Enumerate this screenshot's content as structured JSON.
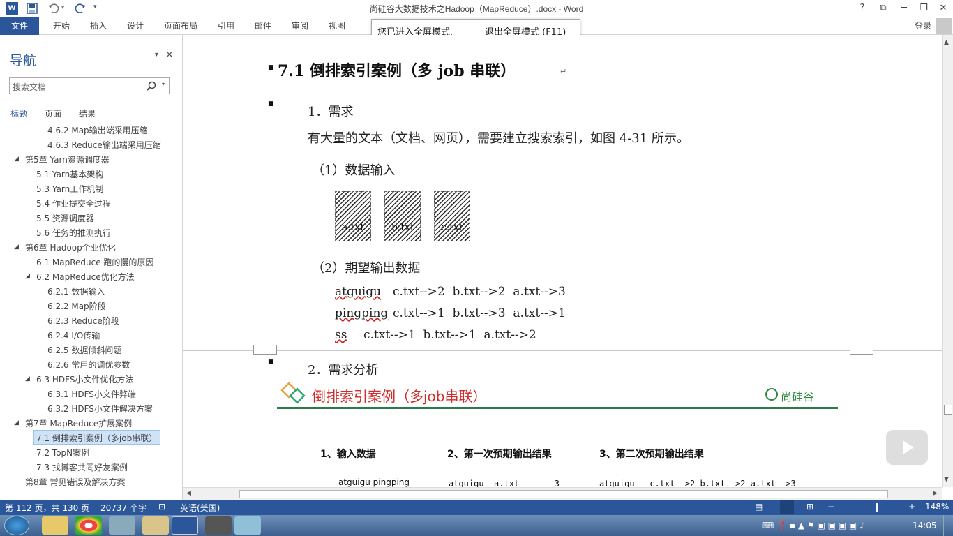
{
  "window": {
    "title": "尚硅谷大数据技术之Hadoop（MapReduce）.docx - Word",
    "word_logo": "W",
    "help": "?",
    "restore": "⧉",
    "minimize": "─",
    "maximize": "❐",
    "close": "✕"
  },
  "ribbon": {
    "tabs": [
      "文件",
      "开始",
      "插入",
      "设计",
      "页面布局",
      "引用",
      "邮件",
      "审阅",
      "视图"
    ],
    "login": "登录"
  },
  "fullscreen_tip": {
    "message": "您已进入全屏模式.",
    "exit_link": "退出全屏模式 (F11)"
  },
  "nav": {
    "title": "导航",
    "search_placeholder": "搜索文档",
    "tabs": [
      "标题",
      "页面",
      "结果"
    ],
    "tree": [
      {
        "text": "4.6.2 Map输出端采用压缩",
        "level": 3,
        "arrow": ""
      },
      {
        "text": "4.6.3 Reduce输出端采用压缩",
        "level": 3,
        "arrow": ""
      },
      {
        "text": "第5章 Yarn资源调度器",
        "level": 1,
        "arrow": "◢"
      },
      {
        "text": "5.1 Yarn基本架构",
        "level": 2,
        "arrow": ""
      },
      {
        "text": "5.3 Yarn工作机制",
        "level": 2,
        "arrow": ""
      },
      {
        "text": "5.4 作业提交全过程",
        "level": 2,
        "arrow": ""
      },
      {
        "text": "5.5 资源调度器",
        "level": 2,
        "arrow": ""
      },
      {
        "text": "5.6 任务的推测执行",
        "level": 2,
        "arrow": ""
      },
      {
        "text": "第6章 Hadoop企业优化",
        "level": 1,
        "arrow": "◢"
      },
      {
        "text": "6.1 MapReduce 跑的慢的原因",
        "level": 2,
        "arrow": ""
      },
      {
        "text": "6.2 MapReduce优化方法",
        "level": 2,
        "arrow": "◢"
      },
      {
        "text": "6.2.1 数据输入",
        "level": 3,
        "arrow": ""
      },
      {
        "text": "6.2.2 Map阶段",
        "level": 3,
        "arrow": ""
      },
      {
        "text": "6.2.3 Reduce阶段",
        "level": 3,
        "arrow": ""
      },
      {
        "text": "6.2.4 I/O传输",
        "level": 3,
        "arrow": ""
      },
      {
        "text": "6.2.5 数据倾斜问题",
        "level": 3,
        "arrow": ""
      },
      {
        "text": "6.2.6 常用的调优参数",
        "level": 3,
        "arrow": ""
      },
      {
        "text": "6.3 HDFS小文件优化方法",
        "level": 2,
        "arrow": "◢"
      },
      {
        "text": "6.3.1 HDFS小文件弊端",
        "level": 3,
        "arrow": ""
      },
      {
        "text": "6.3.2 HDFS小文件解决方案",
        "level": 3,
        "arrow": ""
      },
      {
        "text": "第7章 MapReduce扩展案例",
        "level": 1,
        "arrow": "◢"
      },
      {
        "text": "7.1 倒排索引案例（多job串联）",
        "level": 2,
        "arrow": ""
      },
      {
        "text": "7.2 TopN案例",
        "level": 2,
        "arrow": ""
      },
      {
        "text": "7.3 找博客共同好友案例",
        "level": 2,
        "arrow": ""
      },
      {
        "text": "第8章 常见错误及解决方案",
        "level": 1,
        "arrow": ""
      }
    ]
  },
  "doc": {
    "heading": "7.1  倒排索引案例（多 job 串联）",
    "sec1": "1．需求",
    "desc": "有大量的文本（文档、网页），需要建立搜索索引，如图 4-31 所示。",
    "input_title": "（1）数据输入",
    "files": [
      "a.txt",
      "b.txt",
      "c.txt"
    ],
    "output_title": "（2）期望输出数据",
    "rows": [
      {
        "word": "atguigu",
        "values": "c.txt-->2  b.txt-->2  a.txt-->3"
      },
      {
        "word": "pingping",
        "values": "c.txt-->1  b.txt-->3  a.txt-->1"
      },
      {
        "word": "ss",
        "values": "c.txt-->1  b.txt-->1  a.txt-->2"
      }
    ],
    "sec2": "2．需求分析",
    "banner_title": "倒排索引案例（多job串联）",
    "banner_logo": "尚硅谷",
    "cols": [
      "1、输入数据",
      "2、第一次预期输出结果",
      "3、第二次预期输出结果"
    ],
    "col_row": [
      "atguigu pingping",
      "atguigu--a.txt       3",
      "atguigu   c.txt-->2 b.txt-->2 a.txt-->3"
    ]
  },
  "status": {
    "page": "第 112 页，共 130 页",
    "words": "20737 个字",
    "lang": "英语(美国)",
    "zoom": "148%"
  },
  "taskbar": {
    "time": "14:05"
  }
}
